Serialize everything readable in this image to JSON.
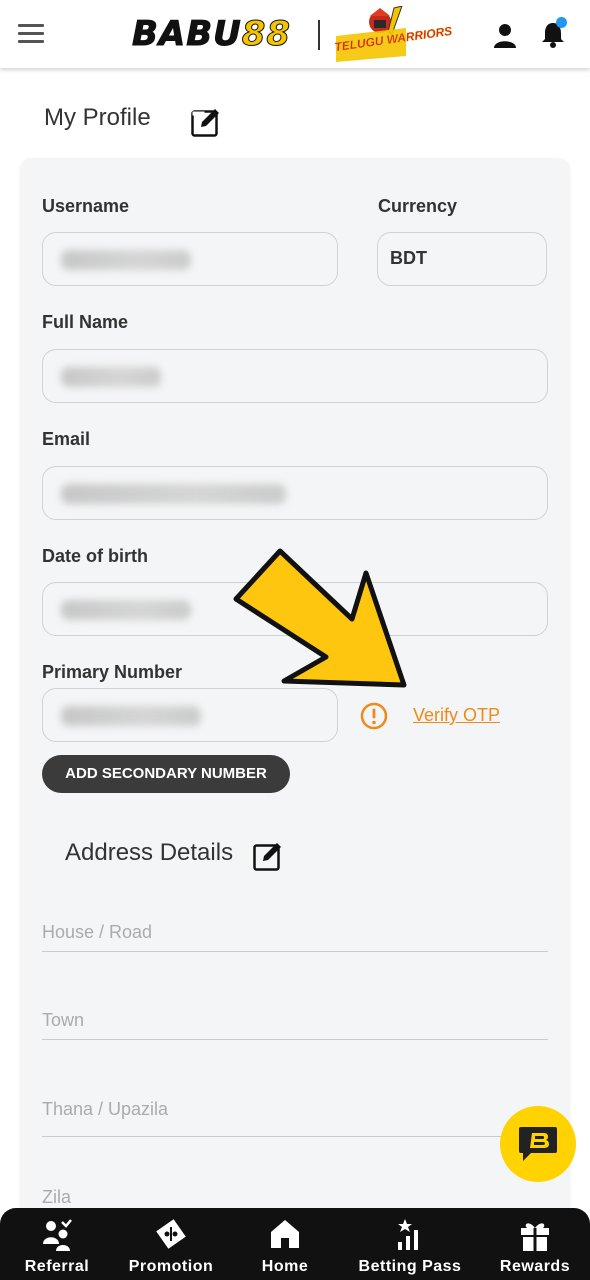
{
  "header": {
    "logo_main": "BABU",
    "logo_accent": "88",
    "team_logo_text": "TELUGU WARRIORS",
    "notification_dot_color": "#2196f3"
  },
  "profile": {
    "title": "My Profile",
    "username_label": "Username",
    "currency_label": "Currency",
    "currency_value": "BDT",
    "fullname_label": "Full Name",
    "email_label": "Email",
    "dob_label": "Date of birth",
    "primary_number_label": "Primary Number",
    "verify_otp": "Verify OTP",
    "add_secondary": "ADD SECONDARY NUMBER"
  },
  "address": {
    "title": "Address Details",
    "house_placeholder": "House / Road",
    "town_placeholder": "Town",
    "thana_placeholder": "Thana / Upazila",
    "zila_placeholder": "Zila"
  },
  "nav": {
    "items": [
      {
        "label": "Referral",
        "icon": "referral-icon"
      },
      {
        "label": "Promotion",
        "icon": "promotion-tag-icon"
      },
      {
        "label": "Home",
        "icon": "home-icon"
      },
      {
        "label": "Betting Pass",
        "icon": "betting-pass-icon"
      },
      {
        "label": "Rewards",
        "icon": "gift-icon"
      }
    ]
  },
  "colors": {
    "accent_yellow": "#f5c400",
    "verify_orange": "#ef8a1a",
    "dark_button": "#3b3b3b",
    "nav_background": "#111111"
  }
}
